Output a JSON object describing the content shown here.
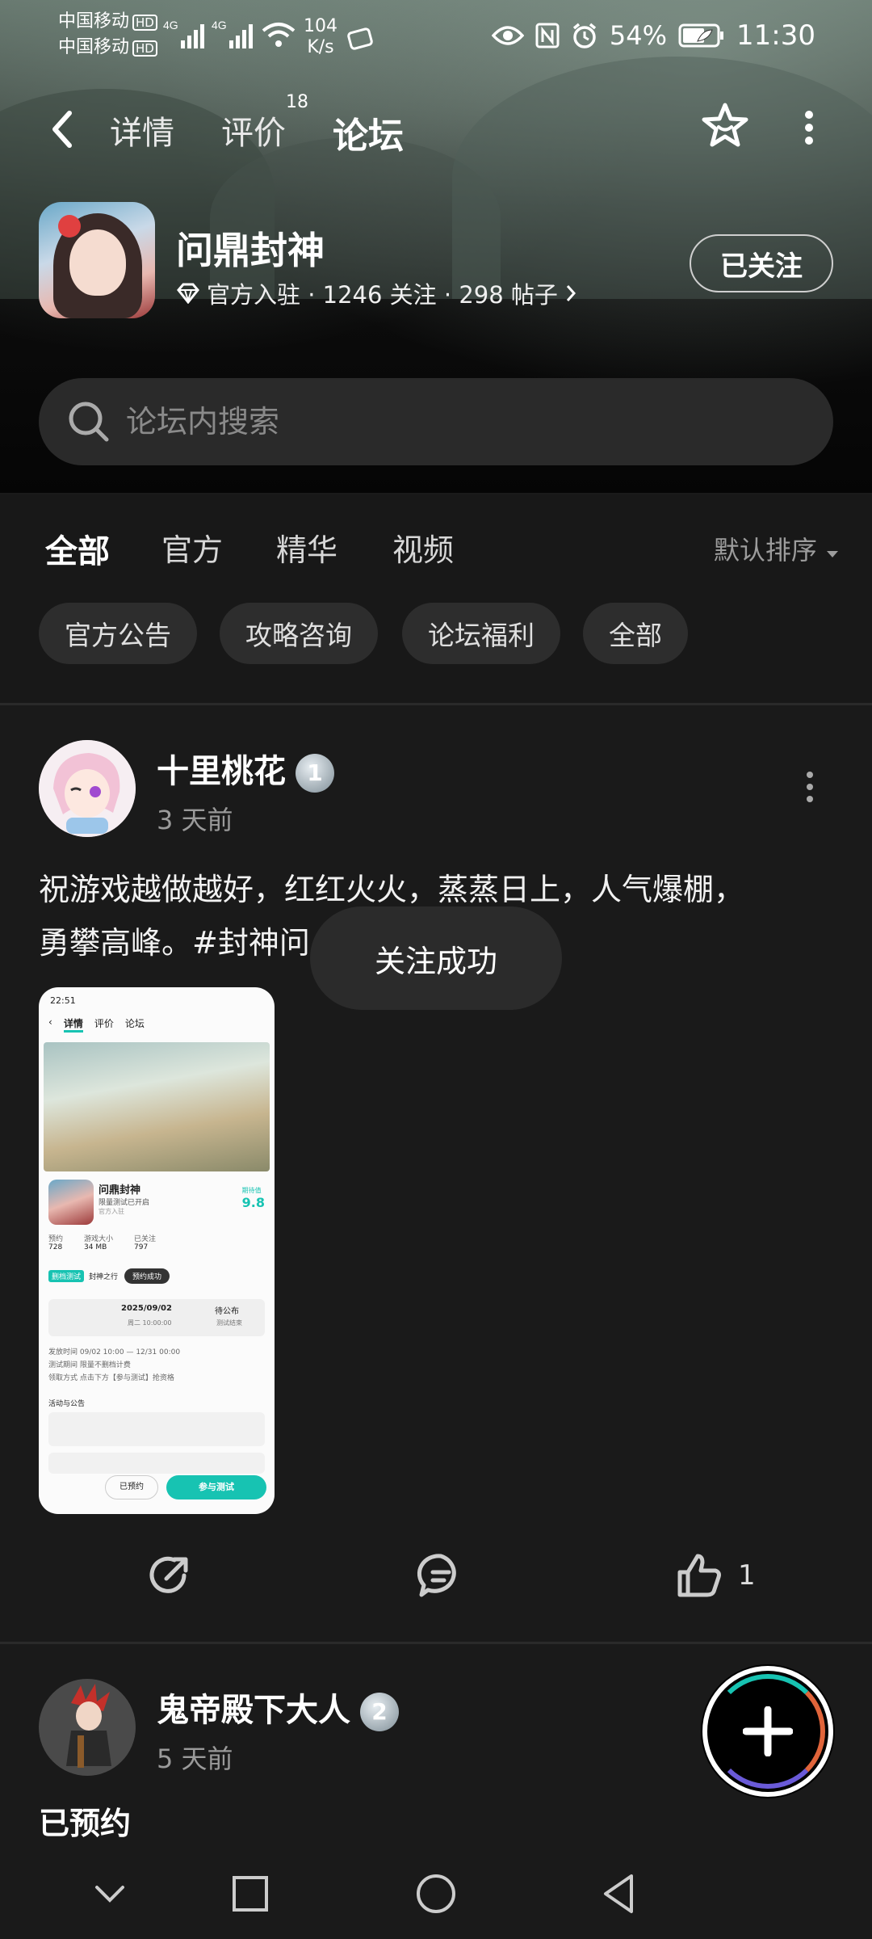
{
  "status_bar": {
    "carrier1": "中国移动",
    "carrier2": "中国移动",
    "hd": "HD",
    "net1": "4G",
    "net2": "4G",
    "speed_value": "104",
    "speed_unit": "K/s",
    "battery": "54%",
    "time": "11:30"
  },
  "nav": {
    "tabs": [
      {
        "label": "详情"
      },
      {
        "label": "评价",
        "badge": "18"
      },
      {
        "label": "论坛"
      }
    ]
  },
  "game": {
    "title": "问鼎封神",
    "meta": "官方入驻 · 1246 关注 · 298 帖子",
    "follow_label": "已关注"
  },
  "search": {
    "placeholder": "论坛内搜索"
  },
  "filters": {
    "tabs": [
      "全部",
      "官方",
      "精华",
      "视频"
    ],
    "sort_label": "默认排序",
    "chips": [
      "官方公告",
      "攻略咨询",
      "论坛福利",
      "全部"
    ]
  },
  "posts": [
    {
      "author": "十里桃花",
      "level": "1",
      "time": "3 天前",
      "content_line1": "祝游戏越做越好，红红火火，蒸蒸日上，人气爆棚，",
      "content_line2": "勇攀高峰。#封神问",
      "like_count": "1",
      "screenshot": {
        "time": "22:51",
        "tab_detail": "详情",
        "tab_review": "评价",
        "tab_forum": "论坛",
        "game_name": "问鼎封神",
        "subtitle": "限量测试已开启",
        "official": "官方入驻",
        "score_label": "期待值",
        "score": "9.8",
        "stat1_label": "预约",
        "stat1_value": "728",
        "stat2_label": "游戏大小",
        "stat2_value": "34 MB",
        "stat3_label": "已关注",
        "stat3_value": "797",
        "test_label": "删档测试",
        "test_name": "封神之行",
        "toast": "预约成功",
        "date": "2025/09/02",
        "weekday": "周二 10:00:00",
        "pending": "待公布",
        "end_label": "测试结束",
        "info1": "发放时间  09/02 10:00 — 12/31 00:00",
        "info2": "测试期间  限量不删档计费",
        "info3": "领取方式  点击下方【参与测试】抢资格",
        "activity": "活动与公告",
        "reserved": "已预约",
        "join": "参与测试"
      }
    },
    {
      "author": "鬼帝殿下大人",
      "level": "2",
      "time": "5 天前",
      "content_line1": "已预约"
    }
  ],
  "toast": "关注成功",
  "colors": {
    "accent": "#17c3b2",
    "background": "#1a1a1a",
    "chip_bg": "#2d2d2d"
  }
}
